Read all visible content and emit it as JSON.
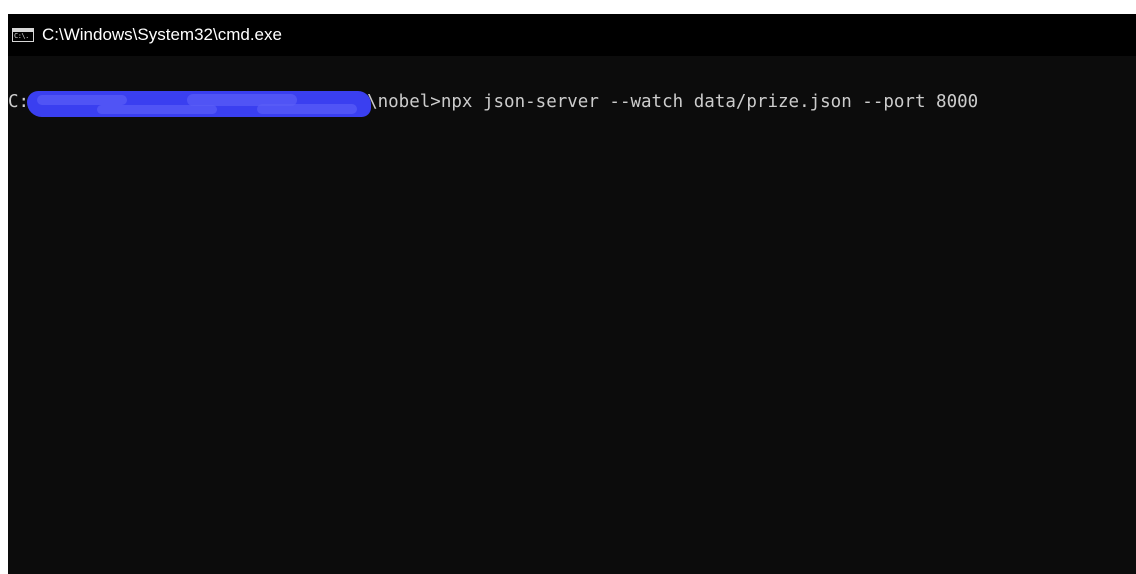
{
  "window": {
    "title": "C:\\Windows\\System32\\cmd.exe",
    "icon": "cmd-icon",
    "icon_label": "C:\\."
  },
  "console": {
    "drive": "C:",
    "redacted": true,
    "path_tail": "\\nobel>",
    "command": "npx json-server --watch data/prize.json --port 8000"
  },
  "colors": {
    "console_bg": "#0c0c0c",
    "titlebar_bg": "#000000",
    "text": "#cccccc",
    "redaction": "#3a3ff0"
  }
}
